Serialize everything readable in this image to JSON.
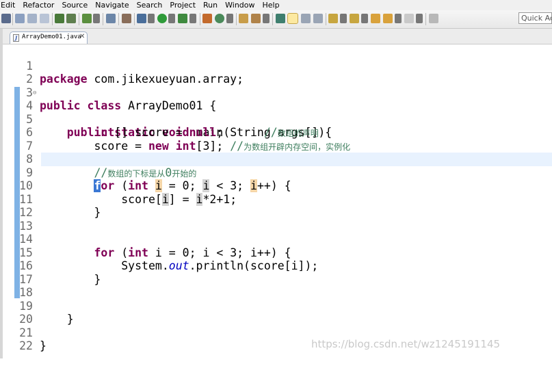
{
  "menu": [
    "Edit",
    "Refactor",
    "Source",
    "Navigate",
    "Search",
    "Project",
    "Run",
    "Window",
    "Help"
  ],
  "quick_access": "Quick Acc",
  "tab": {
    "name": "ArrayDemo01.java",
    "close": "✕",
    "icon": "J"
  },
  "code_lines": [
    {
      "n": "1"
    },
    {
      "n": "2"
    },
    {
      "n": "3"
    },
    {
      "n": "4"
    },
    {
      "n": "5"
    },
    {
      "n": "6"
    },
    {
      "n": "7"
    },
    {
      "n": "8"
    },
    {
      "n": "9"
    },
    {
      "n": "10"
    },
    {
      "n": "11"
    },
    {
      "n": "12"
    },
    {
      "n": "13"
    },
    {
      "n": "14"
    },
    {
      "n": "15"
    },
    {
      "n": "16"
    },
    {
      "n": "17"
    },
    {
      "n": "18"
    },
    {
      "n": "19"
    },
    {
      "n": "20"
    },
    {
      "n": "21"
    },
    {
      "n": "22"
    }
  ],
  "code": {
    "l1_kw": "package",
    "l1_rest": " com.jikexueyuan.array;",
    "l3_kw1": "public",
    "l3_kw2": "class",
    "l3_rest": " ArrayDemo01 {",
    "l4_kw1": "public",
    "l4_kw2": "static",
    "l4_kw3": "void",
    "l4_rest": " main(String args[]){",
    "l5_kw1": "int",
    "l5_mid": "[] score = ",
    "l5_kw2": "null",
    "l5_semi": ";      ",
    "l5_cm_slash": "//",
    "l5_cm": "数组的声明",
    "l6_pre": "score = ",
    "l6_kw1": "new",
    "l6_kw2": "int",
    "l6_mid": "[3]; ",
    "l6_cm_slash": "//",
    "l6_cm": "为数组开辟内存空间，实例化",
    "l8_cm_slash": "//",
    "l8_cm_a": "数组的下标是从",
    "l8_cm_zero": "0",
    "l8_cm_b": "开始的",
    "l9_for_a": "f",
    "l9_for_b": "or",
    "l9_p1": " (",
    "l9_kw_int": "int",
    "l9_sp": " ",
    "l9_i1": "i",
    "l9_m1": " = 0; ",
    "l9_i2": "i",
    "l9_m2": " < 3; ",
    "l9_i3": "i",
    "l9_end": "++) {",
    "l10_a": "score[",
    "l10_i1": "i",
    "l10_b": "] = ",
    "l10_i2": "i",
    "l10_c": "*2+1;",
    "l11": "}",
    "l14_for": "for",
    "l14_p": " (",
    "l14_int": "int",
    "l14_rest": " i = 0; i < 3; i++) {",
    "l15_a": "System.",
    "l15_out": "out",
    "l15_b": ".println(score[i]);",
    "l16": "}",
    "l19": "}",
    "l21": "}"
  },
  "watermark": "https://blog.csdn.net/wz1245191145",
  "colors": {
    "keyword": "#7f0055",
    "comment": "#3f7f5f",
    "field": "#0000c0",
    "current_line": "#e8f2fe",
    "selection": "#3b78d4"
  }
}
